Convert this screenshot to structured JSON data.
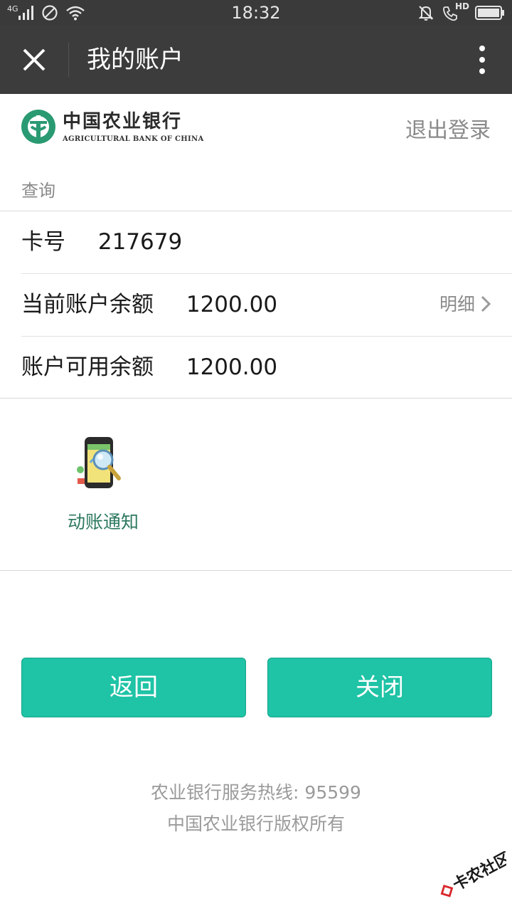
{
  "status_bar": {
    "network": "4G",
    "time": "18:32",
    "hd": "HD"
  },
  "nav": {
    "title": "我的账户"
  },
  "bank": {
    "name_cn": "中国农业银行",
    "name_en": "AGRICULTURAL BANK OF CHINA",
    "logout": "退出登录",
    "brand_color": "#2a9a72"
  },
  "query": {
    "section_label": "查询",
    "rows": [
      {
        "label": "卡号",
        "value": "217679"
      },
      {
        "label": "当前账户余额",
        "value": "1200.00",
        "detail": "明细"
      },
      {
        "label": "账户可用余额",
        "value": "1200.00"
      }
    ]
  },
  "services": [
    {
      "label": "动账通知",
      "icon": "phone-magnifier-icon"
    }
  ],
  "buttons": {
    "back": "返回",
    "close": "关闭",
    "color": "#1fc3a6"
  },
  "footer": {
    "hotline": "农业银行服务热线: 95599",
    "copyright": "中国农业银行版权所有"
  },
  "watermark": {
    "text": "卡农社区"
  }
}
